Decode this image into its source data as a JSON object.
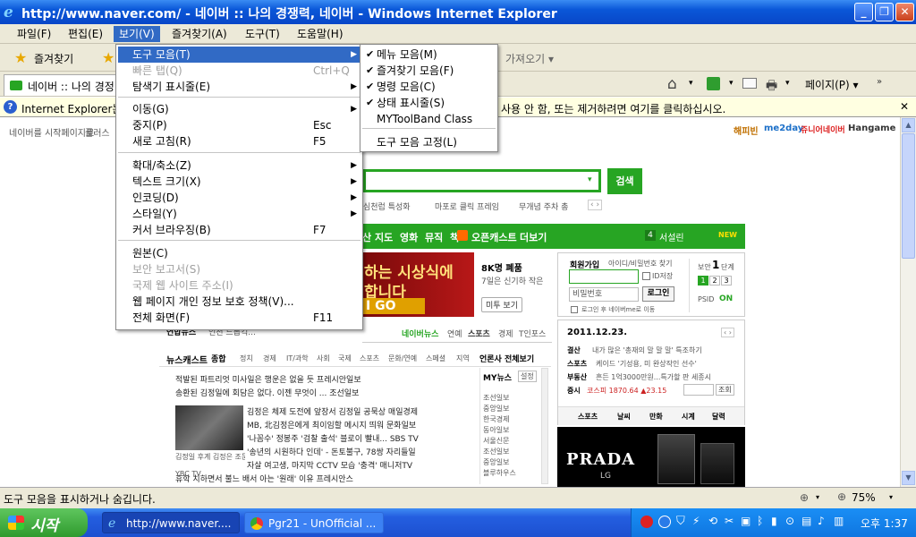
{
  "window": {
    "title": "http://www.naver.com/ - 네이버 :: 나의 경쟁력, 네이버 - Windows Internet Explorer",
    "min_glyph": "_",
    "max_glyph": "❐",
    "close_glyph": "✕"
  },
  "menubar": {
    "items": [
      "파일(F)",
      "편집(E)",
      "보기(V)",
      "즐겨찾기(A)",
      "도구(T)",
      "도움말(H)"
    ]
  },
  "favbar": {
    "favorites_label": "즐겨찾기",
    "tab_title": "네이버 :: 나의 경정",
    "right_tools": [
      "가져오기 ▾"
    ],
    "page_label": "페이지(P) ▾"
  },
  "infobar": {
    "left_text": "Internet Explorer는",
    "right_text": "사용 안 함, 또는 제거하려면 여기를 클릭하십시오.",
    "close_glyph": "✕"
  },
  "view_menu": {
    "items": [
      {
        "label": "도구 모음(T)",
        "shortcut": "",
        "submenu": true,
        "selected": true,
        "disabled": false
      },
      {
        "label": "빠른 탭(Q)",
        "shortcut": "Ctrl+Q",
        "submenu": false,
        "selected": false,
        "disabled": true
      },
      {
        "label": "탐색기 표시줄(E)",
        "shortcut": "",
        "submenu": true,
        "selected": false,
        "disabled": false
      },
      {
        "label": "이동(G)",
        "shortcut": "",
        "submenu": true,
        "selected": false,
        "disabled": false
      },
      {
        "label": "중지(P)",
        "shortcut": "Esc",
        "submenu": false,
        "selected": false,
        "disabled": false
      },
      {
        "label": "새로 고침(R)",
        "shortcut": "F5",
        "submenu": false,
        "selected": false,
        "disabled": false
      },
      {
        "label": "확대/축소(Z)",
        "shortcut": "",
        "submenu": true,
        "selected": false,
        "disabled": false
      },
      {
        "label": "텍스트 크기(X)",
        "shortcut": "",
        "submenu": true,
        "selected": false,
        "disabled": false
      },
      {
        "label": "인코딩(D)",
        "shortcut": "",
        "submenu": true,
        "selected": false,
        "disabled": false
      },
      {
        "label": "스타일(Y)",
        "shortcut": "",
        "submenu": true,
        "selected": false,
        "disabled": false
      },
      {
        "label": "커서 브라우징(B)",
        "shortcut": "F7",
        "submenu": false,
        "selected": false,
        "disabled": false
      },
      {
        "label": "원본(C)",
        "shortcut": "",
        "submenu": false,
        "selected": false,
        "disabled": false
      },
      {
        "label": "보안 보고서(S)",
        "shortcut": "",
        "submenu": false,
        "selected": false,
        "disabled": true
      },
      {
        "label": "국제 웹 사이트 주소(I)",
        "shortcut": "",
        "submenu": false,
        "selected": false,
        "disabled": true
      },
      {
        "label": "웹 페이지 개인 정보 보호 정책(V)...",
        "shortcut": "",
        "submenu": false,
        "selected": false,
        "disabled": false
      },
      {
        "label": "전체 화면(F)",
        "shortcut": "F11",
        "submenu": false,
        "selected": false,
        "disabled": false
      }
    ]
  },
  "toolbar_submenu": {
    "items": [
      {
        "label": "메뉴 모음(M)",
        "checked": true
      },
      {
        "label": "즐겨찾기 모음(F)",
        "checked": true
      },
      {
        "label": "명령 모음(C)",
        "checked": true
      },
      {
        "label": "상태 표시줄(S)",
        "checked": true
      },
      {
        "label": "MYToolBand Class",
        "checked": false
      },
      {
        "label": "도구 모음 고정(L)",
        "checked": false
      }
    ]
  },
  "page": {
    "top_links": [
      "네이버를 시작페이지로",
      "플러스"
    ],
    "top_right_links": [
      "해피빈",
      "me2day",
      "쥬니어네이버",
      "Hangame"
    ],
    "search_button": "검색",
    "search_hint": [
      "심천럽 특성화",
      "마포로 클릭 프레임",
      "무개념 주차 총"
    ],
    "nav_items": [
      "산",
      "지도",
      "영화",
      "뮤직",
      "책",
      "오픈캐스트",
      "더보기"
    ],
    "nav_right": [
      "4",
      "서설린",
      "NEW"
    ],
    "banner_text_1": "하는 시상식에",
    "banner_text_2": "합니다",
    "banner_go": "I GO",
    "banner_side": [
      "8K명 폐품",
      "7일은 신기하 작은",
      "미투 보기"
    ],
    "login": {
      "join": "회원가입",
      "find": "아이디/비밀번호 찾기",
      "password_placeholder": "비밀번호",
      "login_button": "로그인",
      "save_id": "ID저장",
      "security": "로그인 후 네이버me로 이동",
      "mini_label": "보안",
      "mini_num": "1",
      "mini_unit": "단계",
      "pages": [
        "1",
        "2",
        "3"
      ],
      "psid": "PSID",
      "on": "ON"
    },
    "news_tabs": [
      "연합뉴스",
      "인천 드롭킥...",
      "네이버뉴스",
      "연예",
      "스포츠",
      "경제",
      "T인포스"
    ],
    "newscast": "뉴스캐스트",
    "newscast_tabs": [
      "종합",
      "정치",
      "경제",
      "IT/과학",
      "사회",
      "국제",
      "스포츠",
      "문화/연예",
      "스페셜",
      "지역"
    ],
    "newscast_right": "언론사 전체보기",
    "my_news": "MY뉴스",
    "settings": "설정",
    "headlines": [
      "적발된 파트리엇 미사일은 행운은 없을 듯 프레시안일보",
      "송환된 김정일에 회담은 없다. 이젠 무엇이 ... 조선일보",
      "김정은 체제 도전에 앞장서 김정일 공묵상 매일경제",
      "MB, 北김정은에게 최이임할 메시지 띄워 문화일보",
      "'나꼼수' 정봉주 '검찰 출석' 블로이 빨내... SBS TV",
      "'송년의 시원하다 인데' - 돈토불구, 78쌍 자리들일",
      "자살 여고생, 마지막 CCTV 모습 '충격' 매니저TV",
      "휴학 치하면서 불느 배서 아는 '원래' 이유 프레시안스"
    ],
    "photo_caption": [
      "김정일 후계 김정은 조문",
      "YBC TV"
    ],
    "press_list": [
      "조선일보",
      "중앙일보",
      "한국경제",
      "동아일보",
      "서울신문",
      "조선일보",
      "중앙일보",
      "블루하우스"
    ],
    "date": "2011.12.23.",
    "market": [
      {
        "k": "결산",
        "v": "내가 많은 '총재의 말 말 말' 특조하기"
      },
      {
        "k": "스포츠",
        "v": "케이드 '기성용, 미 완상작인 선수'"
      },
      {
        "k": "부동산",
        "v": "흔든 1억3000만원...특가할 판 세종시"
      },
      {
        "k": "증시",
        "v": "코스피 1870.64 ▲23.15"
      }
    ],
    "search_btn2": "조회",
    "bottom_tabs": [
      "스포츠",
      "날씨",
      "만화",
      "시계",
      "달력"
    ],
    "ad_brand": "PRADA",
    "ad_sub": "LG"
  },
  "statusbar": {
    "text": "도구 모음을 표시하거나 숨깁니다.",
    "zoom": "75%"
  },
  "taskbar": {
    "start_label": "시작",
    "tasks": [
      "http://www.naver....",
      "Pgr21 - UnOfficial ..."
    ],
    "clock": "오후 1:37"
  }
}
